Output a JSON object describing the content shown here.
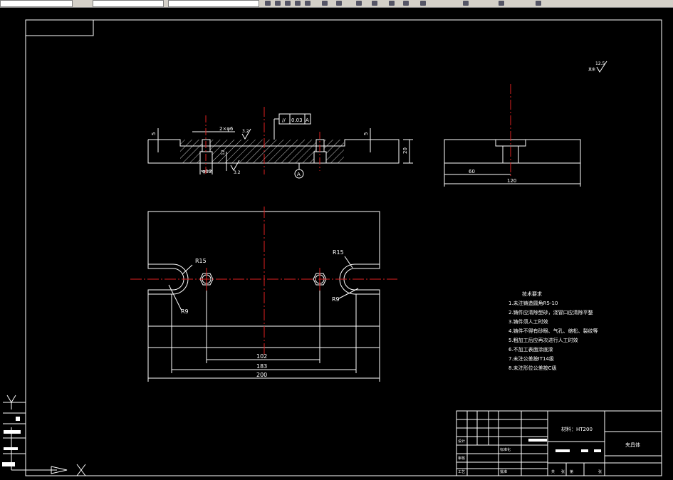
{
  "drawing": {
    "side_view": {
      "dims": {
        "thk_left": "5",
        "thk_right": "5",
        "groove": "2×φ6",
        "height": "20",
        "bore": "φ12",
        "depth": "12"
      },
      "tolerance": {
        "symbol": "//",
        "value": "0.03",
        "datum": "A"
      },
      "roughness": {
        "top": "3.2",
        "bottom": "3.2"
      },
      "datum_label": "A"
    },
    "end_view": {
      "dims": {
        "half_width": "60",
        "width": "120"
      }
    },
    "plan_view": {
      "radius_left": "R15",
      "radius_right": "R15",
      "slot_left": "R9",
      "slot_right": "R9",
      "dims": {
        "hole_spacing": "102",
        "slot_spacing": "183",
        "length": "200"
      }
    },
    "surface_finish": {
      "value": "12.5",
      "label": "其余"
    },
    "notes": {
      "title": "技术要求",
      "items": [
        "1.未注铸造圆角R5-10",
        "2.铸件应清除型砂，浇冒口应清除平整",
        "3.铸件须人工时效",
        "4.铸件不得有砂眼、气孔、缩松、裂纹等",
        "5.粗加工后应再次进行人工时效",
        "6.不加工表面涂底漆",
        "7.未注公差按IT14级",
        "8.未注形位公差按C级"
      ]
    },
    "title_block": {
      "material": "材料：HT200",
      "part_name": "夹具体",
      "cells": [
        "设计",
        "标准化",
        "审核",
        "工艺",
        "批准",
        "共",
        "张",
        "第",
        "张"
      ]
    }
  }
}
